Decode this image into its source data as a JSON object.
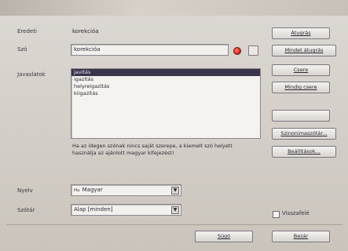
{
  "labels": {
    "original": "Eredeti",
    "word": "Szó",
    "suggestions": "Javaslatok",
    "language": "Nyelv",
    "dictionary": "Szótár"
  },
  "original_word": "korekcióa",
  "word_value": "korekcióa",
  "suggestions": [
    "javítás",
    "igazítás",
    "helyreigazítás",
    "kiigazítás"
  ],
  "note": "Ha az idegen szónak nincs saját szerepe, a kiemelt szó helyett használja az ajánlott magyar kifejezést!",
  "language_value": "Magyar",
  "language_flag": "Hu",
  "dictionary_value": "Alap [minden]",
  "buttons": {
    "ignore": "Átugrás",
    "ignore_all": "Mindet átugrás",
    "replace": "Csere",
    "replace_all": "Mindig csere",
    "empty": "",
    "synonyms": "Szinonimaszótár...",
    "options": "Beállítások...",
    "help": "Súgó",
    "close": "Bezár"
  },
  "undo_label": "Visszafelé",
  "icons": {
    "status": "red-dot-icon",
    "dropdown": "triangle-down"
  }
}
